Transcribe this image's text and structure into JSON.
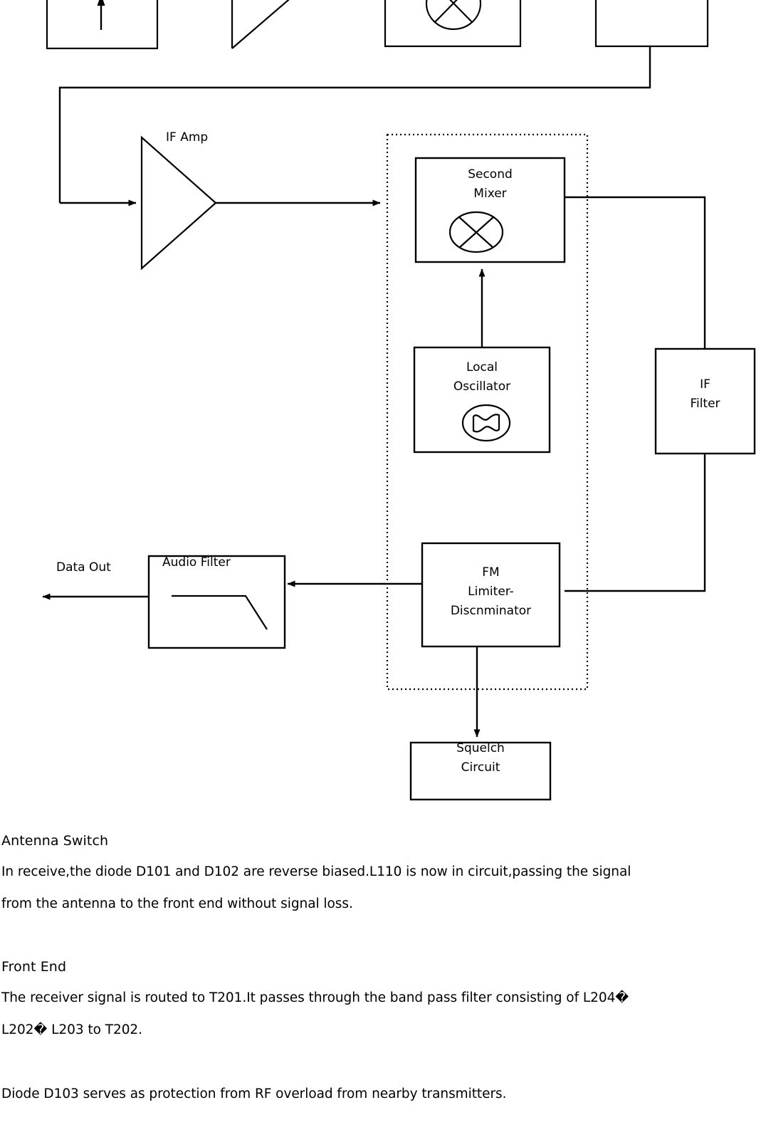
{
  "diagram": {
    "title": "Receiver block diagram (lower portion)",
    "top_row": {
      "antenna_block": {
        "icon": "up-arrow-icon"
      },
      "amplifier_block": {
        "icon": "amplifier-triangle-icon"
      },
      "first_mixer_block": {
        "icon": "mixer-cross-circle-icon"
      },
      "fourth_block": {
        "label": ""
      }
    },
    "blocks": {
      "if_amp": {
        "label": "IF Amp",
        "icon": "amplifier-triangle-icon"
      },
      "second_mixer": {
        "label": "Second\nMixer",
        "icon": "mixer-cross-circle-icon"
      },
      "local_oscillator": {
        "label": "Local\nOscillator",
        "icon": "oscillator-sine-icon"
      },
      "if_filter": {
        "label": "IF\nFilter"
      },
      "fm_limiter": {
        "label": "FM\nLimiter-\nDiscnminator"
      },
      "squelch": {
        "label": "Squelch\nCircuit"
      },
      "audio_filter": {
        "label": "Audio Filter",
        "icon": "lowpass-response-icon"
      }
    },
    "labels": {
      "data_out": "Data Out"
    },
    "colors": {
      "line": "#000000",
      "text": "#000000",
      "background": "#ffffff"
    }
  },
  "prose": {
    "sections": [
      {
        "heading": "Antenna Switch",
        "paragraphs": [
          "In receive,the diode D101 and D102 are reverse biased.L110 is now in circuit,passing the signal",
          "from the antenna to the front end without signal loss."
        ]
      },
      {
        "heading": "Front End",
        "paragraphs": [
          "The receiver signal is routed to T201.It passes through the band pass filter consisting of L204�",
          "L202� L203 to T202."
        ]
      },
      {
        "heading": "",
        "paragraphs": [
          "Diode D103 serves as protection from RF overload from nearby transmitters."
        ]
      }
    ]
  }
}
